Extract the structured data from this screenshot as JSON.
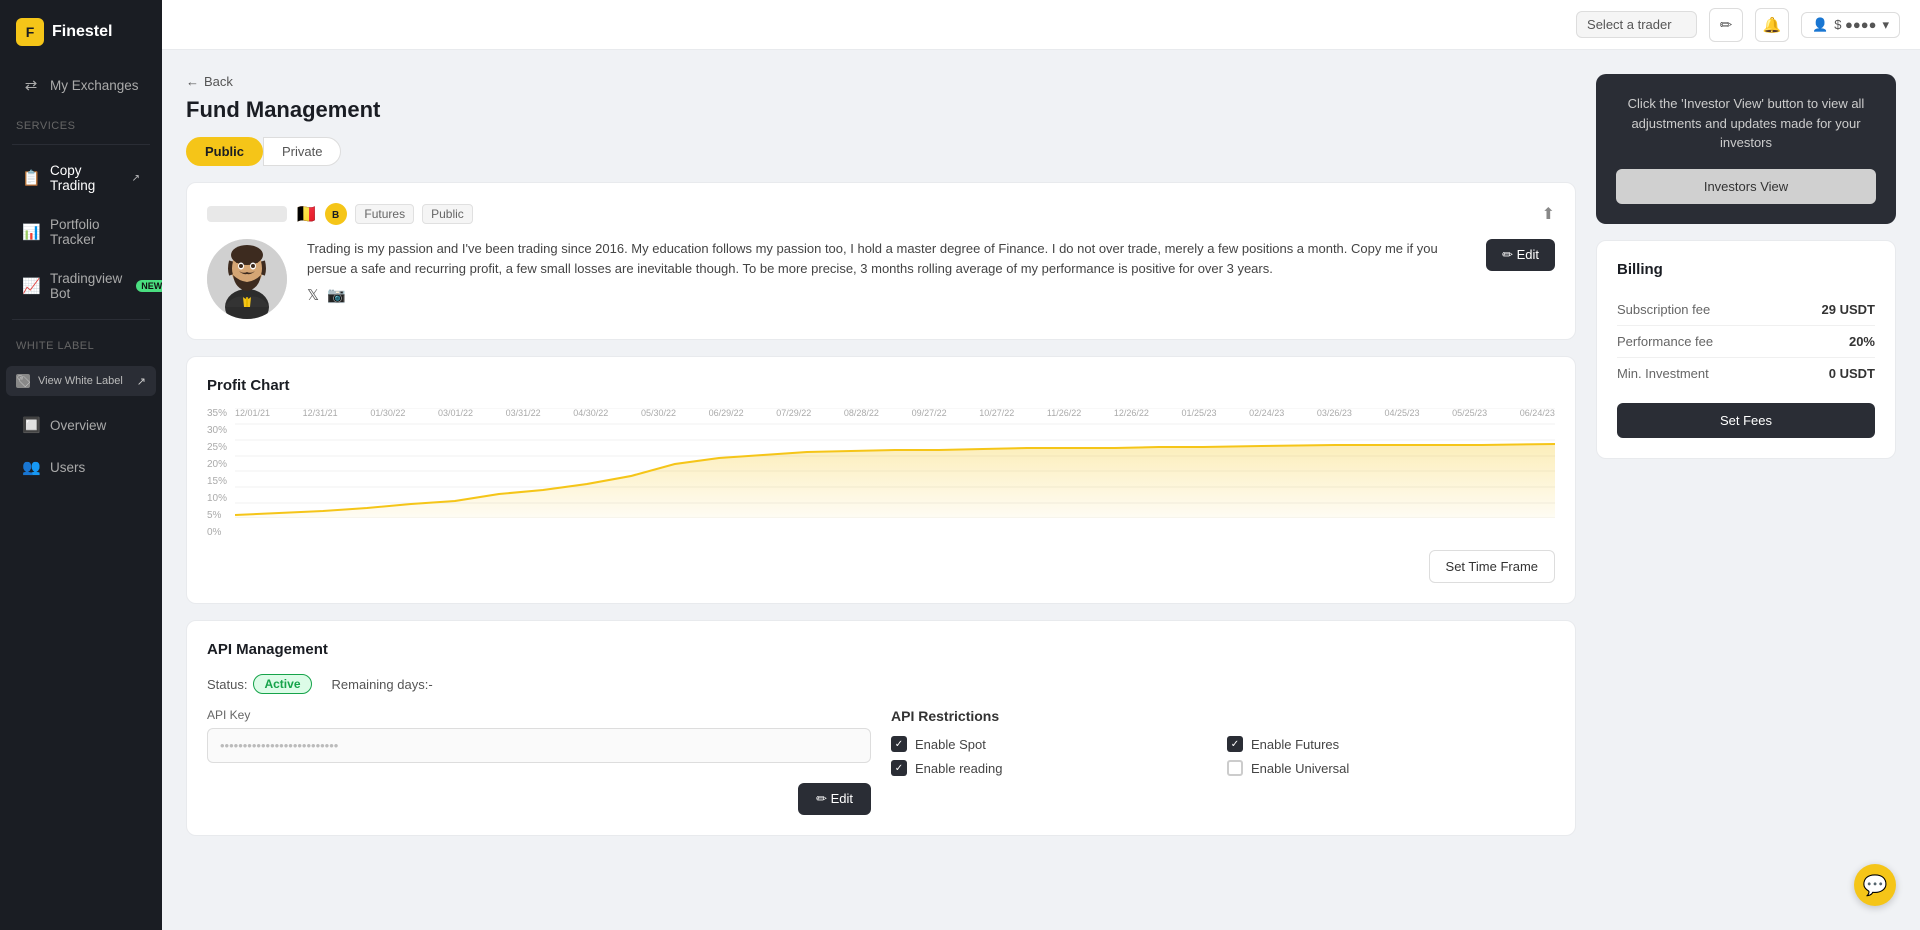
{
  "app": {
    "name": "Finestel"
  },
  "topbar": {
    "select_placeholder": "Select a trader",
    "user_label": "$ ●●●●"
  },
  "sidebar": {
    "my_exchanges": "My Exchanges",
    "services_label": "Services",
    "copy_trading": "Copy Trading",
    "portfolio_tracker": "Portfolio Tracker",
    "tradingview_bot": "Tradingview Bot",
    "white_label_label": "White Label",
    "white_label_btn": "View White Label",
    "overview": "Overview",
    "users": "Users"
  },
  "back": "← Back",
  "page_title": "Fund Management",
  "toggle": {
    "public": "Public",
    "private": "Private"
  },
  "profile": {
    "name_placeholder": "••••••••",
    "flag": "🇧🇪",
    "exchange_label": "B",
    "tag_futures": "Futures",
    "tag_public": "Public",
    "bio": "Trading is my passion and I've been trading since 2016. My education follows my passion too, I hold a master degree of Finance. I do not over trade, merely a few positions a month. Copy me if you persue a safe and recurring profit, a few small losses are inevitable though. To be more precise, 3 months rolling average of my performance is positive for over 3 years.",
    "edit_btn": "✏ Edit"
  },
  "profit_chart": {
    "title": "Profit Chart",
    "y_labels": [
      "35%",
      "30%",
      "25%",
      "20%",
      "15%",
      "10%",
      "5%",
      "0%"
    ],
    "x_labels": [
      "12/01/21",
      "12/31/21",
      "01/30/22",
      "03/01/22",
      "03/31/22",
      "04/30/22",
      "05/30/22",
      "06/29/22",
      "07/29/22",
      "08/28/22",
      "09/27/22",
      "10/27/22",
      "11/26/22",
      "12/26/22",
      "01/25/23",
      "02/24/23",
      "03/26/23",
      "04/25/23",
      "05/25/23",
      "06/24/23"
    ],
    "set_time_frame_btn": "Set Time Frame"
  },
  "api": {
    "title": "API Management",
    "status_label": "Status:",
    "status_value": "Active",
    "remaining_label": "Remaining days:-",
    "api_key_label": "API Key",
    "api_key_placeholder": "••••••••••••••••••••••••••",
    "edit_btn": "✏ Edit",
    "restrictions_title": "API Restrictions",
    "enable_spot": "Enable Spot",
    "enable_reading": "Enable reading",
    "enable_futures": "Enable Futures",
    "enable_universal": "Enable Universal"
  },
  "right_panel": {
    "info_text": "Click the 'Investor View' button to view all adjustments and updates made for your investors",
    "investors_view_btn": "Investors View",
    "billing_title": "Billing",
    "subscription_fee_label": "Subscription fee",
    "subscription_fee_value": "29 USDT",
    "performance_fee_label": "Performance fee",
    "performance_fee_value": "20%",
    "min_investment_label": "Min. Investment",
    "min_investment_value": "0 USDT",
    "set_fees_btn": "Set Fees"
  },
  "chat_icon": "💬"
}
